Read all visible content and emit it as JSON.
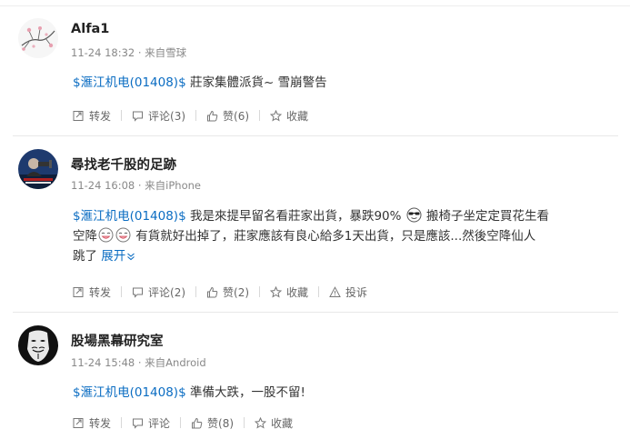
{
  "posts": [
    {
      "username": "Alfa1",
      "meta": "11-24 18:32 · 来自雪球",
      "stock": "$滙江机电(01408)$",
      "text": " 莊家集體派貨~ 雪崩警告",
      "actions": {
        "repost": "转发",
        "comment": "评论(3)",
        "like": "赞(6)",
        "fav": "收藏"
      }
    },
    {
      "username": "尋找老千股的足跡",
      "meta": "11-24 16:08 · 来自iPhone",
      "stock": "$滙江机电(01408)$",
      "text_line1": " 我是來提早留名看莊家出貨，暴跌90%",
      "text_line1_end": " 搬椅子坐定定買花生看",
      "text_line2_a": "空降",
      "text_line2_b": " 有貨就好出掉了，莊家應該有良心給多1天出貨，只是應該...然後空降仙人",
      "text_line3": "跳了",
      "expand": "展开",
      "actions": {
        "repost": "转发",
        "comment": "评论(2)",
        "like": "赞(2)",
        "fav": "收藏",
        "report": "投诉"
      }
    },
    {
      "username": "股場黑幕研究室",
      "meta": "11-24 15:48 · 来自Android",
      "stock": "$滙江机电(01408)$",
      "text": " 準備大跌，一股不留!",
      "actions": {
        "repost": "转发",
        "comment": "评论",
        "like": "赞(8)",
        "fav": "收藏"
      }
    }
  ],
  "icons": {
    "repost": "repost-icon",
    "comment": "comment-icon",
    "like": "thumbs-up-icon",
    "fav": "star-icon",
    "report": "warning-icon",
    "expand": "chevron-down-icon"
  },
  "colors": {
    "link": "#0a6cc2",
    "meta": "#888888",
    "text": "#333333"
  }
}
